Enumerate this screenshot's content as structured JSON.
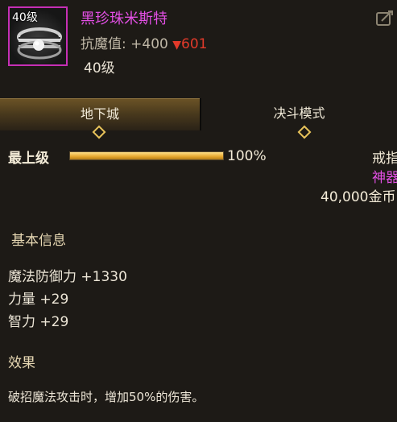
{
  "item": {
    "level_badge": "40级",
    "name": "黑珍珠米斯特",
    "resist_label": "抗魔值: +400",
    "resist_down": "601",
    "level_text": "40级"
  },
  "tabs": [
    {
      "label": "地下城",
      "active": true
    },
    {
      "label": "决斗模式",
      "active": false
    }
  ],
  "progress": {
    "label": "最上级",
    "percent_text": "100%",
    "value": 1.0
  },
  "meta": {
    "type": "戒指",
    "rarity": "神器",
    "price": "40,000金币"
  },
  "sections": {
    "basic_title": "基本信息",
    "stats": [
      "魔法防御力 +1330",
      "力量 +29",
      "智力 +29"
    ],
    "effect_title": "效果",
    "effect_text": "破招魔法攻击时，增加50%的伤害。"
  },
  "colors": {
    "background": "#1d1a16",
    "rarity_purple": "#e24fe4",
    "down_red": "#e23a2a",
    "gold_accent": "#e8c35a"
  }
}
